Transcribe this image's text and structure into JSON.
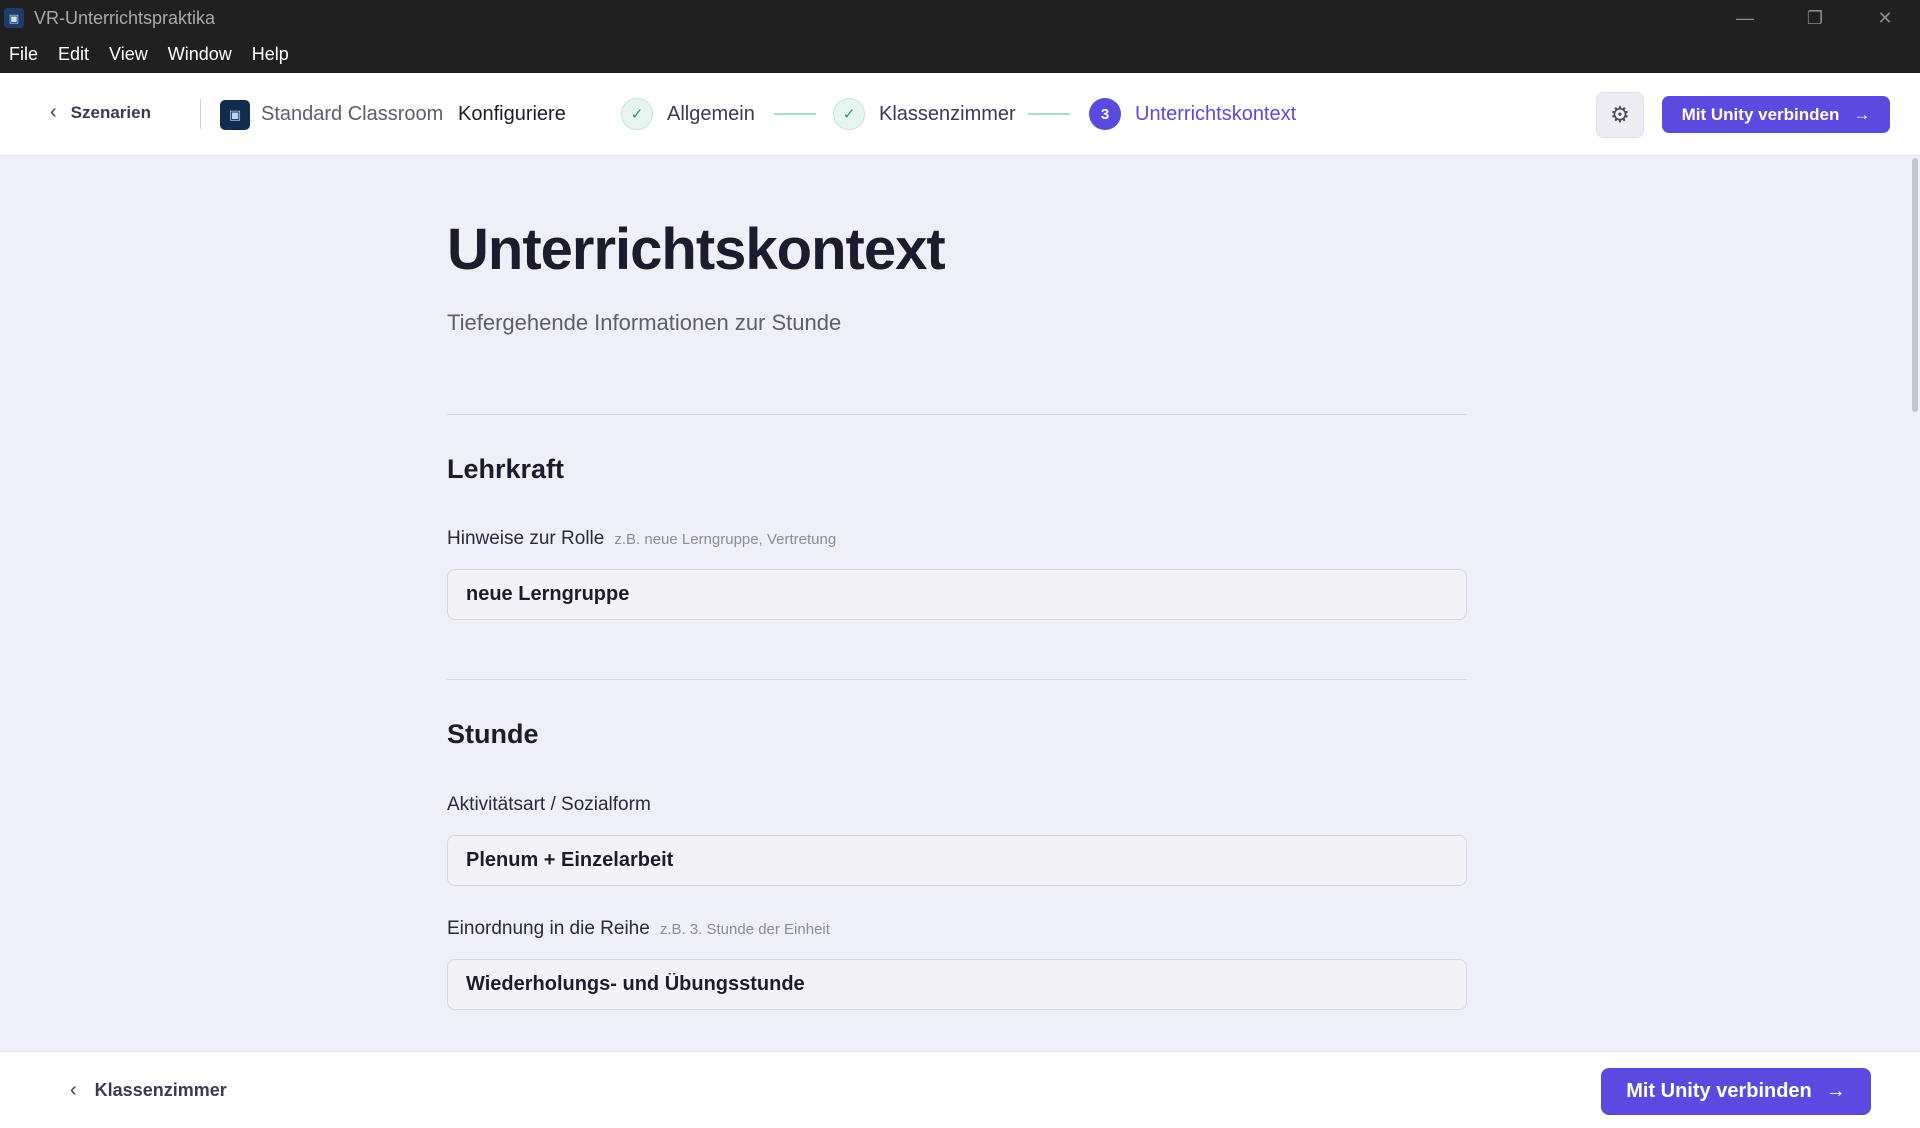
{
  "window": {
    "title": "VR-Unterrichtspraktika",
    "icon": "app-logo-icon",
    "controls": [
      "minimize-icon",
      "restore-icon",
      "close-icon"
    ]
  },
  "menu": [
    "File",
    "Edit",
    "View",
    "Window",
    "Help"
  ],
  "header": {
    "back_label": "Szenarien",
    "scenario_name": "Standard Classroom",
    "mode_label": "Konfiguriere",
    "steps": [
      {
        "label": "Allgemein",
        "state": "done"
      },
      {
        "label": "Klassenzimmer",
        "state": "done"
      },
      {
        "number": "3",
        "label": "Unterrichtskontext",
        "state": "active"
      }
    ],
    "settings_icon": "gear-icon",
    "connect_label": "Mit Unity verbinden"
  },
  "main": {
    "title": "Unterrichtskontext",
    "subtitle": "Tiefergehende Informationen zur Stunde",
    "sections": [
      {
        "title": "Lehrkraft",
        "fields": [
          {
            "label": "Hinweise zur Rolle",
            "hint": "z.B. neue Lerngruppe, Vertretung",
            "value": "neue Lerngruppe"
          }
        ]
      },
      {
        "title": "Stunde",
        "fields": [
          {
            "label": "Aktivitätsart / Sozialform",
            "hint": "",
            "value": "Plenum + Einzelarbeit"
          },
          {
            "label": "Einordnung in die Reihe",
            "hint": "z.B. 3. Stunde der Einheit",
            "value": "Wiederholungs- und Übungsstunde"
          }
        ]
      }
    ]
  },
  "footer": {
    "back_label": "Klassenzimmer",
    "connect_label": "Mit Unity verbinden"
  },
  "colors": {
    "accent": "#5a4ae0",
    "success": "#2f9b6d",
    "background": "#efeff7"
  }
}
